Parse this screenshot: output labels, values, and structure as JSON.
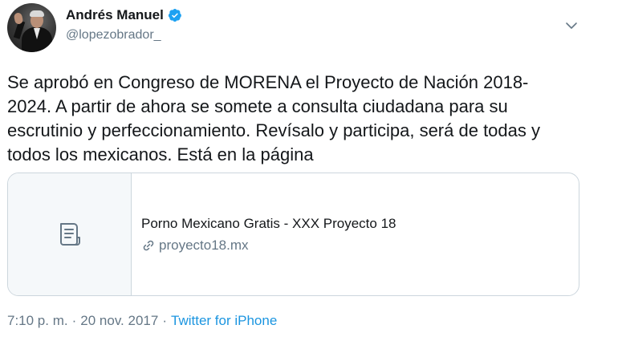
{
  "author": {
    "display_name": "Andrés Manuel",
    "handle": "@lopezobrador_"
  },
  "tweet": {
    "text": "Se aprobó en Congreso de MORENA el Proyecto de Nación 2018-\n2024. A partir de ahora se somete a consulta ciudadana para su\nescrutinio y perfeccionamiento. Revísalo y participa, será de todas y\ntodos los mexicanos. Está en la página"
  },
  "card": {
    "title": "Porno Mexicano Gratis - XXX Proyecto 18",
    "url": "proyecto18.mx"
  },
  "meta": {
    "time": "7:10 p. m.",
    "separator1": "·",
    "date": "20 nov. 2017",
    "separator2": "·",
    "source": "Twitter for iPhone"
  },
  "colors": {
    "verified": "#1da1f2",
    "link": "#1b95e0",
    "secondary_text": "#657786",
    "border": "#ccd6dd"
  }
}
